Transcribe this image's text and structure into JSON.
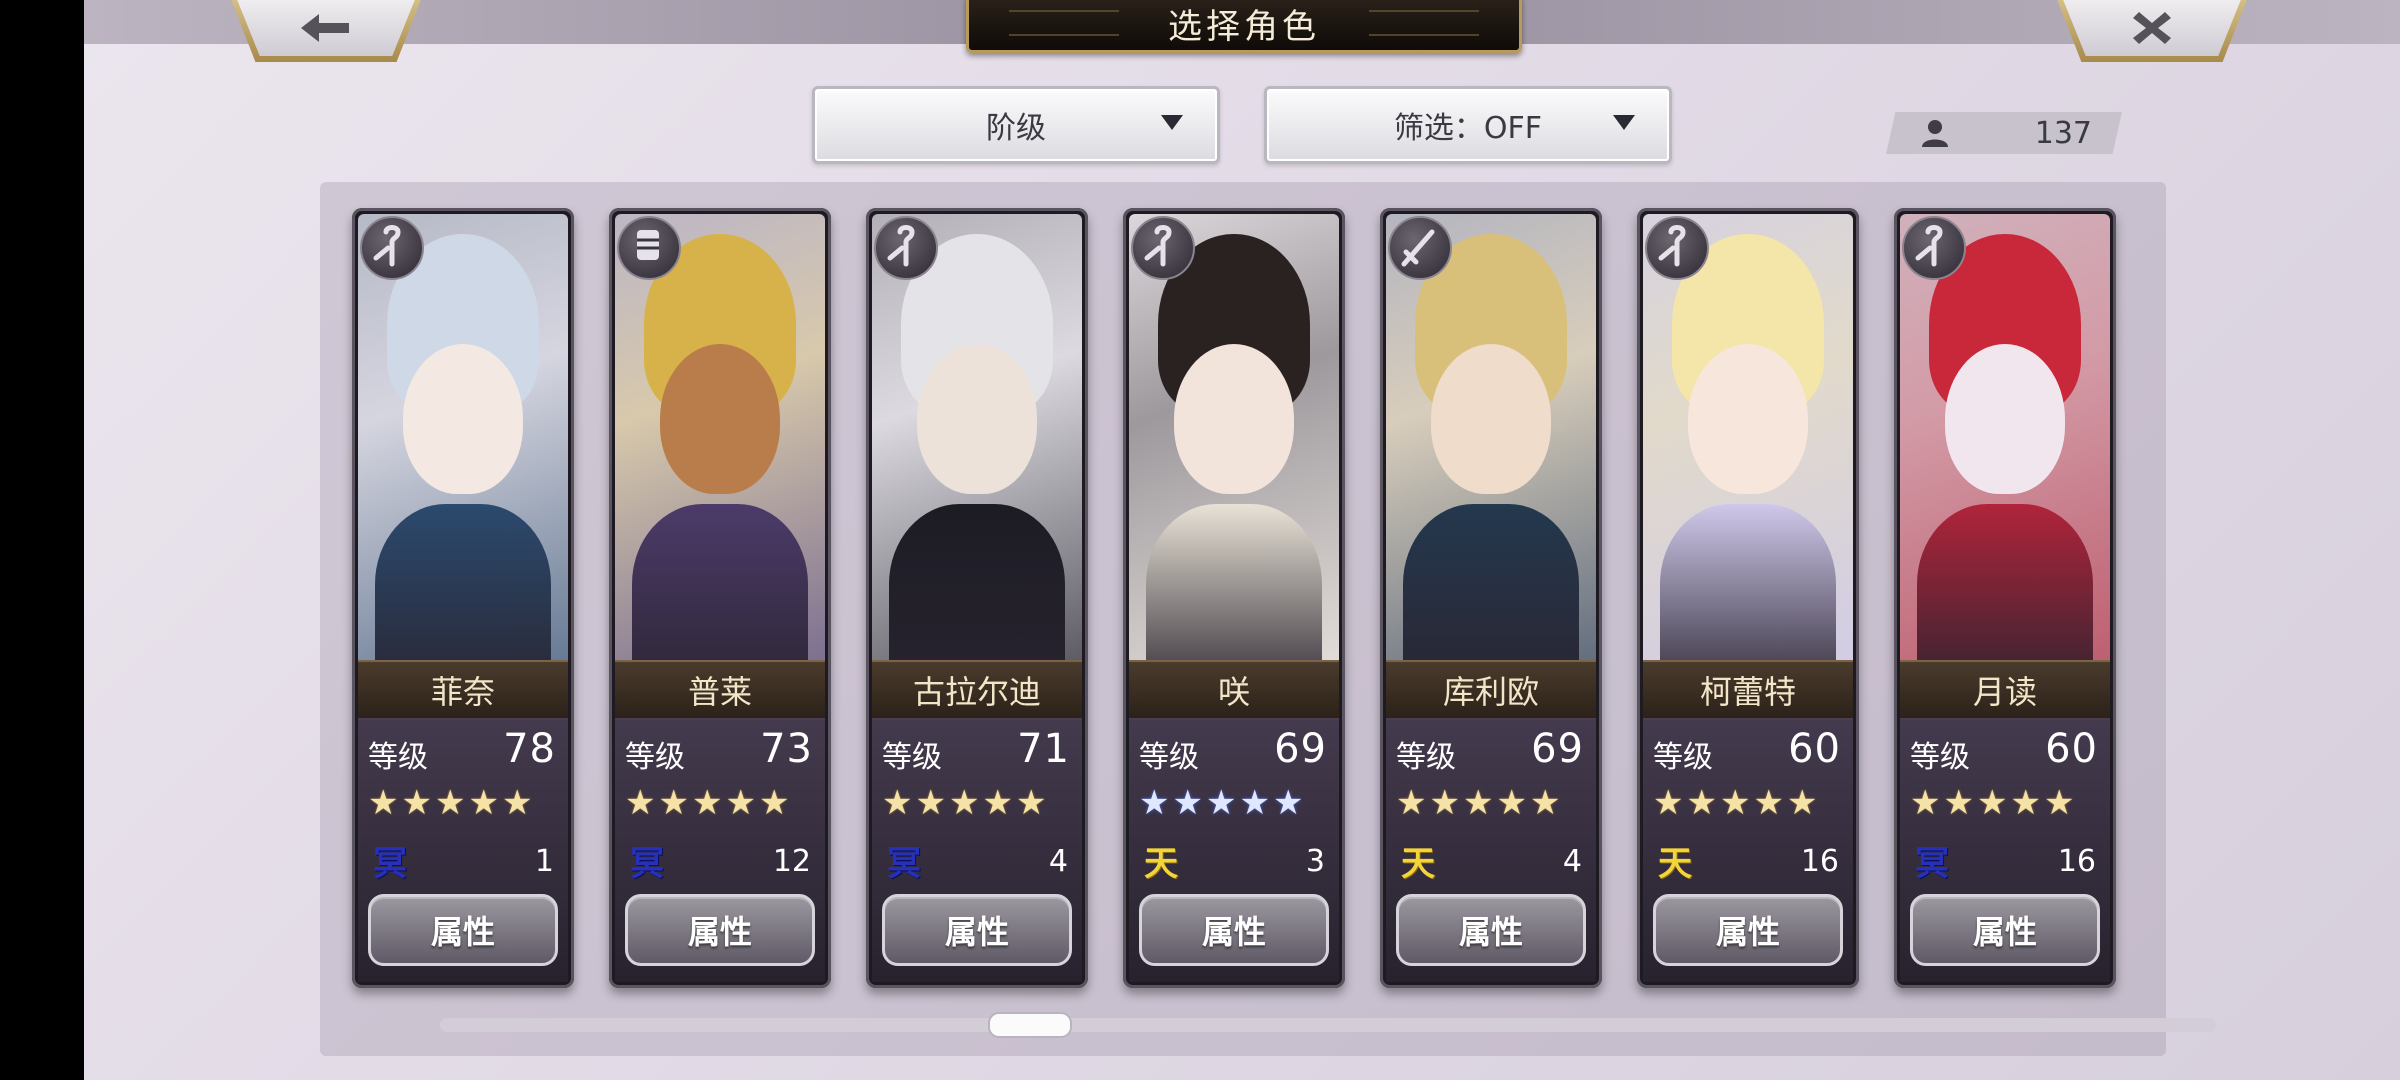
{
  "header": {
    "title": "选择角色",
    "back_icon": "arrow-left-icon",
    "close_icon": "close-x-icon"
  },
  "filters": {
    "sort_label": "阶级",
    "filter_label": "筛选：OFF"
  },
  "roster": {
    "icon": "user-icon",
    "count": "137"
  },
  "characters": [
    {
      "name": "菲奈",
      "level_label": "等级",
      "level": "78",
      "stars": 5,
      "star_color": "gold",
      "element": "冥",
      "element_type": "dark",
      "slot": "1",
      "button": "属性",
      "class_icon": "staff-icon",
      "palette": [
        "#cfd8e6",
        "#f4e9e2",
        "#2b4a6e"
      ]
    },
    {
      "name": "普莱",
      "level_label": "等级",
      "level": "73",
      "stars": 5,
      "star_color": "gold",
      "element": "冥",
      "element_type": "dark",
      "slot": "12",
      "button": "属性",
      "class_icon": "gauntlet-icon",
      "palette": [
        "#d7b24a",
        "#b97c4b",
        "#4c3b6a"
      ]
    },
    {
      "name": "古拉尔迪",
      "level_label": "等级",
      "level": "71",
      "stars": 5,
      "star_color": "gold",
      "element": "冥",
      "element_type": "dark",
      "slot": "4",
      "button": "属性",
      "class_icon": "staff-icon",
      "palette": [
        "#e4e4e8",
        "#ece2da",
        "#1c1c24"
      ]
    },
    {
      "name": "咲",
      "level_label": "等级",
      "level": "69",
      "stars": 5,
      "star_color": "blue",
      "element": "天",
      "element_type": "light",
      "slot": "3",
      "button": "属性",
      "class_icon": "staff-icon",
      "palette": [
        "#2a2220",
        "#f2e4da",
        "#e8e2d6"
      ]
    },
    {
      "name": "库利欧",
      "level_label": "等级",
      "level": "69",
      "stars": 5,
      "star_color": "gold",
      "element": "天",
      "element_type": "light",
      "slot": "4",
      "button": "属性",
      "class_icon": "sword-icon",
      "palette": [
        "#d8c07a",
        "#f0dccb",
        "#24384e"
      ]
    },
    {
      "name": "柯蕾特",
      "level_label": "等级",
      "level": "60",
      "stars": 5,
      "star_color": "gold",
      "element": "天",
      "element_type": "light",
      "slot": "16",
      "button": "属性",
      "class_icon": "staff-icon",
      "palette": [
        "#f4e6a8",
        "#f6e6dc",
        "#cfc8ea"
      ]
    },
    {
      "name": "月读",
      "level_label": "等级",
      "level": "60",
      "stars": 5,
      "star_color": "gold",
      "element": "冥",
      "element_type": "dark",
      "slot": "16",
      "button": "属性",
      "class_icon": "staff-icon",
      "palette": [
        "#c8283a",
        "#f2e6ee",
        "#b0243a"
      ]
    }
  ],
  "scroll": {
    "position": 0.22
  }
}
